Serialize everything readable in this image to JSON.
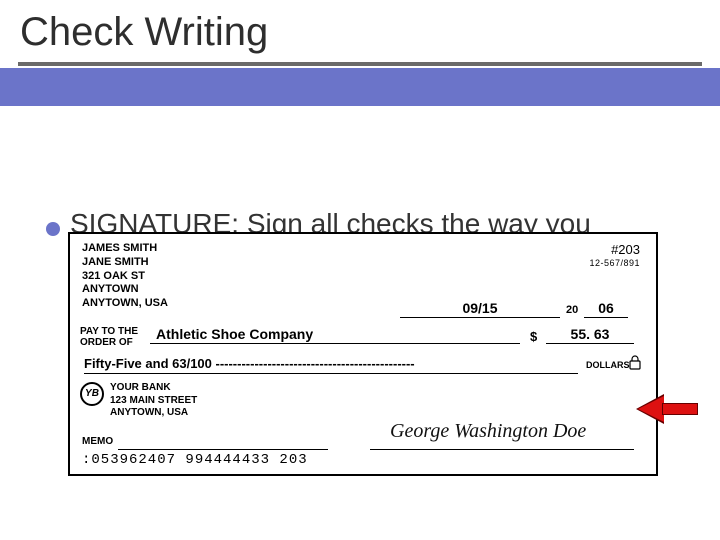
{
  "slide": {
    "title": "Check Writing",
    "bullet": "SIGNATURE:  Sign all checks the way you"
  },
  "check": {
    "holder": {
      "name1": "JAMES SMITH",
      "name2": "JANE SMITH",
      "street": "321 OAK ST",
      "city": "ANYTOWN",
      "country": "ANYTOWN, USA"
    },
    "number_label": "#203",
    "routing_small": "12-567/891",
    "date": "09/15",
    "century": "20",
    "year": "06",
    "pay_to_label_line1": "PAY TO THE",
    "pay_to_label_line2": "ORDER OF",
    "payee": "Athletic Shoe Company",
    "dollar_sign": "$",
    "amount_numeric": "55. 63",
    "amount_words": "Fifty-Five and 63/100 ----------------------------------------------",
    "dollars_label": "DOLLARS",
    "bank": {
      "logo": "YB",
      "name": "YOUR BANK",
      "street": "123 MAIN STREET",
      "city": "ANYTOWN, USA"
    },
    "memo_label": "MEMO",
    "signature": "George Washington Doe",
    "micr": ":053962407  994444433  203"
  }
}
